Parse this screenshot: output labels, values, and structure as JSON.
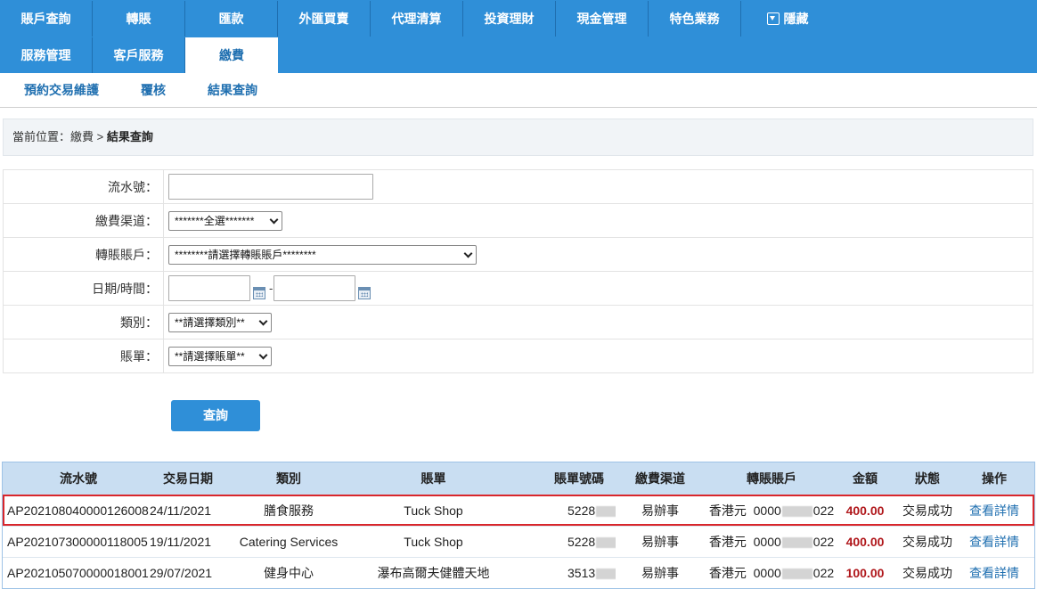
{
  "nav": {
    "row1": [
      "賬戶查詢",
      "轉賬",
      "匯款",
      "外匯買賣",
      "代理清算",
      "投資理財",
      "現金管理",
      "特色業務"
    ],
    "hide_label": "隱藏",
    "row2": [
      "服務管理",
      "客戶服務",
      "繳費"
    ],
    "active": "繳費"
  },
  "subnav": [
    "預約交易維護",
    "覆核",
    "結果查詢"
  ],
  "breadcrumb": {
    "prefix": "當前位置：繳費 > ",
    "current": "結果查詢"
  },
  "form": {
    "serial_label": "流水號：",
    "serial_value": "",
    "channel_label": "繳費渠道：",
    "channel_value": "*******全選*******",
    "account_label": "轉賬賬戶：",
    "account_value": "********請選擇轉賬賬戶********",
    "datetime_label": "日期/時間：",
    "date_from": "",
    "date_sep": "-",
    "date_to": "",
    "category_label": "類別：",
    "category_value": "**請選擇類別**",
    "bill_label": "賬單：",
    "bill_value": "**請選擇賬單**",
    "query_button": "查詢"
  },
  "table": {
    "headers": [
      "流水號",
      "交易日期",
      "類別",
      "賬單",
      "賬單號碼",
      "繳費渠道",
      "轉賬賬戶",
      "金額",
      "狀態",
      "操作"
    ],
    "rows": [
      {
        "serial": "AP202108040000126008",
        "date": "24/11/2021",
        "category": "膳食服務",
        "bill": "Tuck Shop",
        "bill_no_prefix": "5228",
        "channel": "易辦事",
        "account_ccy": "香港元",
        "account_prefix": "0000",
        "account_suffix": "022",
        "amount": "400.00",
        "status": "交易成功",
        "action": "查看詳情"
      },
      {
        "serial": "AP202107300000118005",
        "date": "19/11/2021",
        "category": "Catering Services",
        "bill": "Tuck Shop",
        "bill_no_prefix": "5228",
        "channel": "易辦事",
        "account_ccy": "香港元",
        "account_prefix": "0000",
        "account_suffix": "022",
        "amount": "400.00",
        "status": "交易成功",
        "action": "查看詳情"
      },
      {
        "serial": "AP202105070000018001",
        "date": "29/07/2021",
        "category": "健身中心",
        "bill": "瀑布高爾夫健體天地",
        "bill_no_prefix": "3513",
        "channel": "易辦事",
        "account_ccy": "香港元",
        "account_prefix": "0000",
        "account_suffix": "022",
        "amount": "100.00",
        "status": "交易成功",
        "action": "查看詳情"
      }
    ]
  },
  "colors": {
    "nav_bg": "#2f8fd8",
    "header_bg": "#c9def2",
    "amount": "#b0171b",
    "highlight": "#d9262c"
  }
}
